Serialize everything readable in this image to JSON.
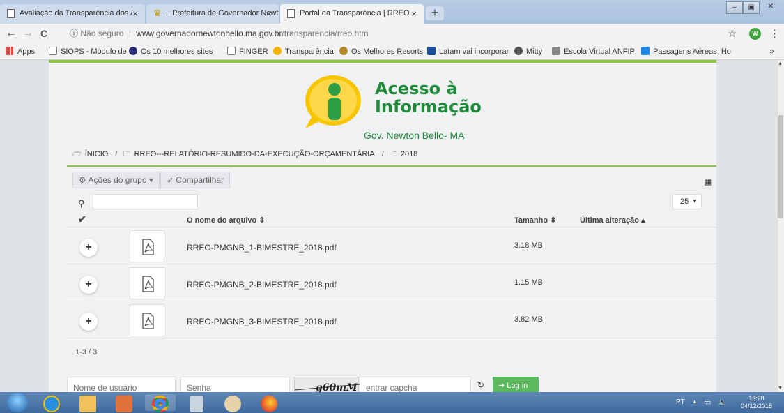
{
  "browser": {
    "tabs": [
      {
        "title": "Avaliação da Transparência dos /",
        "close": "×",
        "active": false
      },
      {
        "title": ".: Prefeitura de Governador Newt",
        "close": "×",
        "active": false
      },
      {
        "title": "Portal da Transparência | RREO",
        "close": "×",
        "active": true
      }
    ],
    "new_tab": "+",
    "window_controls": {
      "minimize": "–",
      "maximize": "▣",
      "close": "✕"
    },
    "nav": {
      "back": "←",
      "forward": "→",
      "reload": "C"
    },
    "address": {
      "security": "Não seguro",
      "url_host": "www.governadornewtonbello.ma.gov.br",
      "url_path": "/transparencia/rreo.htm"
    },
    "bookmark_star": "☆",
    "profile_initial": "W",
    "menu": "⋮",
    "bookmarks": [
      {
        "label": "Apps",
        "color": "#e8453c"
      },
      {
        "label": "SIOPS - Módulo de C",
        "color": "#ffffff"
      },
      {
        "label": "Os 10 melhores sites",
        "color": "#2b2f7a"
      },
      {
        "label": "FINGER",
        "color": "#ffffff"
      },
      {
        "label": "Transparência",
        "color": "#f2b400"
      },
      {
        "label": "Os Melhores Resorts",
        "color": "#b38a2b"
      },
      {
        "label": "Latam vai incorporar",
        "color": "#1b4f9c"
      },
      {
        "label": "Mitty",
        "color": "#555555"
      },
      {
        "label": "Escola Virtual ANFIP",
        "color": "#888888"
      },
      {
        "label": "Passagens Aéreas, Ho",
        "color": "#1e88e5"
      }
    ],
    "bookmarks_more": "»"
  },
  "page": {
    "logo": {
      "title_line1": "Acesso à",
      "title_line2": "Informação",
      "subtitle": "Gov. Newton Bello- MA",
      "brand_green": "#1e8a3a",
      "brand_yellow": "#f7c600"
    },
    "breadcrumb": {
      "home": "ÍNICIO",
      "level1": "RREO---RELATÓRIO-RESUMIDO-DA-EXECUÇÃO-ORÇAMENTÁRIA",
      "level2": "2018",
      "separator": "/"
    },
    "toolbar": {
      "group_actions": "Ações do grupo ▾",
      "share": "Compartilhar"
    },
    "search": {
      "placeholder": ""
    },
    "page_size": "25",
    "table": {
      "col_name": "O nome do arquivo ⇕",
      "col_size": "Tamanho ⇕",
      "col_modified": "Última alteração ▴",
      "rows": [
        {
          "name": "RREO-PMGNB_1-BIMESTRE_2018.pdf",
          "size": "3.18 MB",
          "modified": ""
        },
        {
          "name": "RREO-PMGNB_2-BIMESTRE_2018.pdf",
          "size": "1.15 MB",
          "modified": ""
        },
        {
          "name": "RREO-PMGNB_3-BIMESTRE_2018.pdf",
          "size": "3.82 MB",
          "modified": ""
        }
      ],
      "count": "1-3 / 3"
    },
    "login": {
      "username_placeholder": "Nome de usuário",
      "password_placeholder": "Senha",
      "captcha_text": "g60mM",
      "captcha_placeholder": "entrar capcha",
      "login_button": "Log in"
    },
    "accent": "#8dc63f"
  },
  "taskbar": {
    "language": "PT",
    "time": "13:28",
    "date": "04/12/2018"
  }
}
